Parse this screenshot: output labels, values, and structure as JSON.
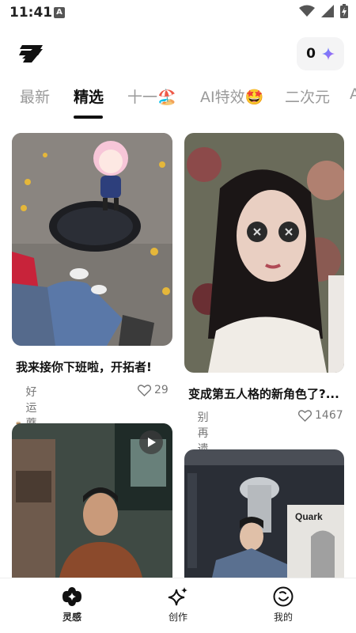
{
  "status_bar": {
    "time": "11:41",
    "notification_glyph": "A",
    "icons": [
      "wifi-icon",
      "signal-icon",
      "battery-charging-icon"
    ]
  },
  "header": {
    "logo_icon": "lightning-logo-icon",
    "points": "0",
    "points_icon": "sparkle-icon",
    "accent_color": "#7b5cf0"
  },
  "tabs": [
    {
      "label": "最新"
    },
    {
      "label": "精选",
      "active": true
    },
    {
      "label": "十一🏖️"
    },
    {
      "label": "AI特效🤩"
    },
    {
      "label": "二次元"
    },
    {
      "label": "A"
    }
  ],
  "feed": {
    "cards": [
      {
        "title": "我来接你下班啦，开拓者!",
        "author": "好运蘑菇王",
        "likes": "29"
      },
      {
        "title": "变成第五人格的新角色了?...",
        "author": "别再遗忘小猫",
        "likes": "1467"
      },
      {
        "thumb_badge": "play-icon"
      },
      {
        "thumb_text": "Quark"
      }
    ]
  },
  "bottom_nav": [
    {
      "label": "灵感",
      "icon": "inspiration-icon",
      "active": true
    },
    {
      "label": "创作",
      "icon": "sparkle-create-icon"
    },
    {
      "label": "我的",
      "icon": "profile-face-icon"
    }
  ]
}
